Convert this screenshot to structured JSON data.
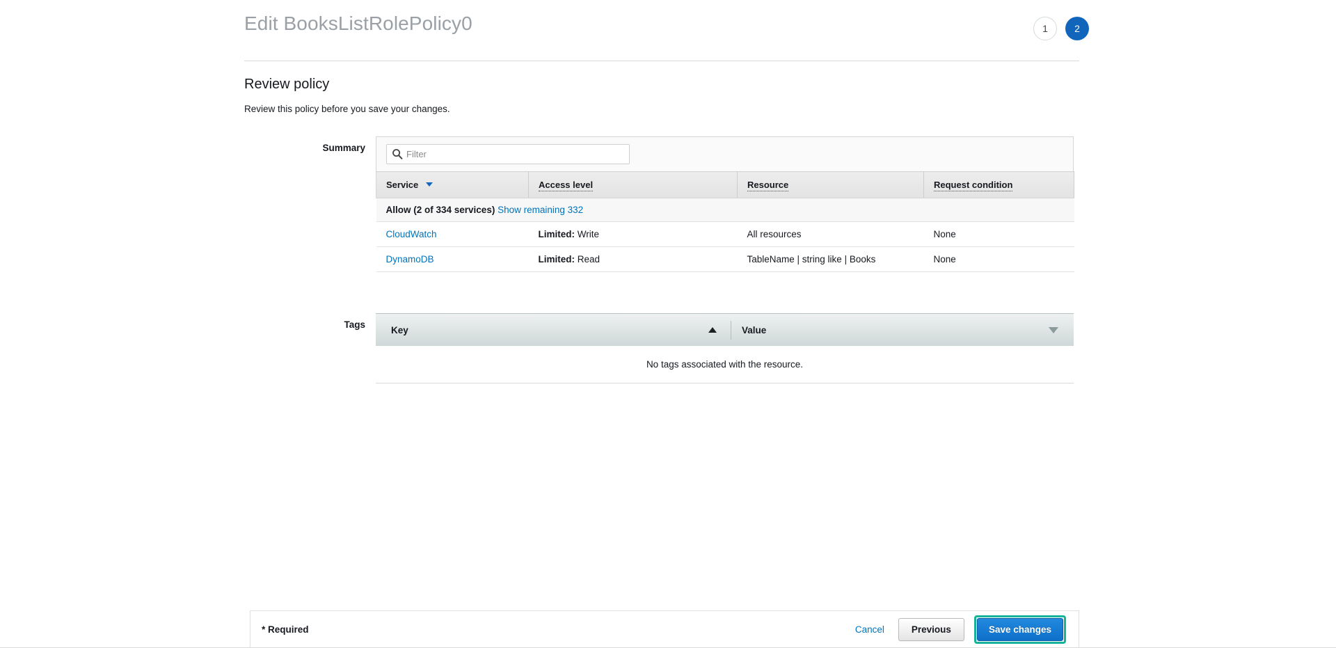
{
  "header": {
    "title": "Edit BooksListRolePolicy0",
    "steps": [
      {
        "label": "1",
        "state": "inactive"
      },
      {
        "label": "2",
        "state": "active"
      }
    ]
  },
  "section": {
    "title": "Review policy",
    "subtitle": "Review this policy before you save your changes."
  },
  "summary": {
    "label": "Summary",
    "filter": {
      "value": "",
      "placeholder": "Filter",
      "icon": "search-icon"
    },
    "columns": [
      {
        "label": "Service",
        "sort": "desc",
        "tooltip": false
      },
      {
        "label": "Access level",
        "tooltip": true
      },
      {
        "label": "Resource",
        "tooltip": true
      },
      {
        "label": "Request condition",
        "tooltip": true
      }
    ],
    "group_row": {
      "text": "Allow (2 of 334 services)",
      "link": "Show remaining 332"
    },
    "rows": [
      {
        "service": "CloudWatch",
        "access_level_prefix": "Limited:",
        "access_level_value": "Write",
        "resource": "All resources",
        "request_condition": "None"
      },
      {
        "service": "DynamoDB",
        "access_level_prefix": "Limited:",
        "access_level_value": "Read",
        "resource": "TableName | string like | Books",
        "request_condition": "None"
      }
    ]
  },
  "tags": {
    "label": "Tags",
    "columns": [
      {
        "label": "Key",
        "sort": "asc"
      },
      {
        "label": "Value",
        "sort": "none"
      }
    ],
    "empty_message": "No tags associated with the resource."
  },
  "footer": {
    "required_note": "* Required",
    "cancel_label": "Cancel",
    "previous_label": "Previous",
    "save_label": "Save changes"
  },
  "colors": {
    "accent_blue": "#0073bb",
    "step_active": "#1166bb",
    "primary_button": "#1476cd",
    "focus_outline": "#16b39a",
    "link": "#0073bb",
    "title_gray": "#9aa0a6"
  }
}
